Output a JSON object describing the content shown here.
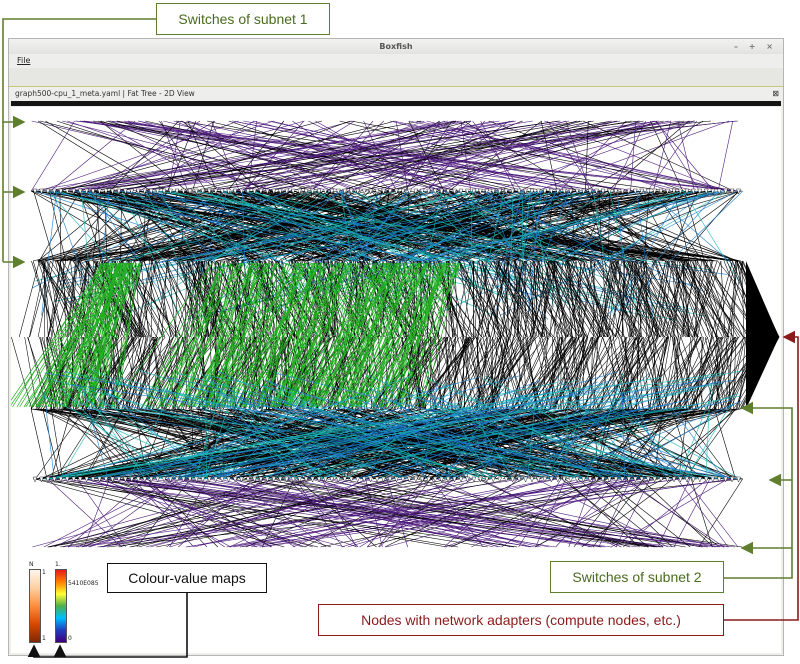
{
  "window": {
    "title": "Boxfish",
    "controls": "– + ×",
    "menu_file": "File",
    "tab_label": "graph500-cpu_1_meta.yaml  |  Fat Tree - 2D View",
    "tab_close": "⊠"
  },
  "colormaps": {
    "left": {
      "top_label": "N",
      "max_label": "1",
      "min_label": "1",
      "colors": [
        "#fff5eb",
        "#fdd0a2",
        "#fd8d3c",
        "#d94801",
        "#7f2704"
      ]
    },
    "right": {
      "top_label": "1.",
      "max_label": "5410E085",
      "min_label": "0",
      "colors": [
        "#e41a1c",
        "#ff7f00",
        "#ffff33",
        "#4daf4a",
        "#00bfff",
        "#1f3fbf",
        "#3f007d"
      ]
    }
  },
  "annotations": {
    "switches_subnet_1": "Switches of subnet 1",
    "switches_subnet_2": "Switches of subnet 2",
    "colour_value_maps": "Colour-value maps",
    "nodes_with_adapters": "Nodes with network adapters (compute nodes, etc.)"
  },
  "colors": {
    "subnet_arrow": "#5f7f2e",
    "node_arrow": "#8b1a1a",
    "link_black": "#000000",
    "link_green": "#22b022",
    "link_blue": "#1a7fd0",
    "link_cyan": "#17b8b8",
    "link_purple": "#4b1a7a"
  }
}
